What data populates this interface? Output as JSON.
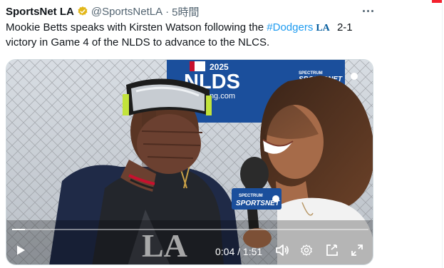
{
  "tweet": {
    "author_name": "SportsNet LA",
    "handle": "@SportsNetLA",
    "separator": "·",
    "time": "5時間",
    "text_part1": "Mookie Betts speaks with Kirsten Watson following the ",
    "hashtag": "#Dodgers",
    "la_emoji": "LA",
    "text_part2": " 2-1 victory in Game 4 of the NLDS to advance to the NLCS.",
    "verified_color": "#e2b719",
    "hashtag_color": "#1d9bf0"
  },
  "video": {
    "banner_year": "2025",
    "banner_title": "NLDS",
    "banner_url_fragment": "king.com",
    "broadcaster_logo_line1": "SPECTRUM",
    "broadcaster_logo_line2": "SPORTSNET",
    "mic_flag_line1": "SPECTRUM",
    "mic_flag_line2": "SPORTSNET",
    "shirt_logo": "LA",
    "progress_fraction": 0.035,
    "current_time": "0:04",
    "time_separator": "/",
    "duration": "1:51"
  },
  "icons": {
    "more": "more-dots-icon",
    "verified": "verified-badge-icon",
    "play": "play-icon",
    "volume": "volume-icon",
    "settings": "gear-icon",
    "pip": "picture-in-picture-icon",
    "fullscreen": "fullscreen-icon"
  }
}
